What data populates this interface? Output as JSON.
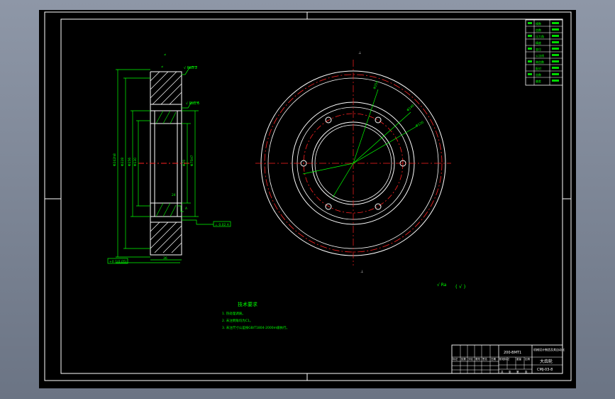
{
  "sheet": {
    "border_color": "#ffffff",
    "accent_colors": {
      "dimension": "#00ff00",
      "centerline": "#ff2020",
      "hatch": "#ffffff",
      "geometry": "#ffffff"
    }
  },
  "side_view": {
    "roughness_label_top": "√ Ra3.2",
    "roughness_label_bore": "√ Ra1.6",
    "tolerance_frame": "⊥ 0.02 A",
    "bottom_dim_left": "+0.1(0.05)",
    "bottom_dim_right": "36",
    "small_mark": "≠",
    "datum_mark": "A"
  },
  "front_view": {
    "top_mark": "⊥",
    "bottom_mark": "⊥"
  },
  "surface_finish_note": {
    "symbol_text": "√ Ra",
    "paren_text": "( √ )"
  },
  "technical_requirements": {
    "title": "技术要求",
    "items": [
      "1. 热处理调质。",
      "2. 未注倒角均为C1。",
      "3. 未注尺寸公差按GB/T1804-2000m级执行。"
    ]
  },
  "param_table": {
    "rows": [
      "模数",
      "齿数",
      "压力角",
      "精度",
      "变位",
      "公法线",
      "跨齿数",
      "配对",
      "齿数",
      "偏差"
    ]
  },
  "title_block": {
    "scale_material": "200-BMT1",
    "school": "机械设计制造及其自动化",
    "part_name": "大齿轮",
    "drawing_number": "CMJ-03-8",
    "grid_labels": [
      "标记",
      "处数",
      "分区",
      "更改",
      "签名",
      "日期"
    ],
    "stage_labels": [
      "阶段标记",
      "重量",
      "比例"
    ],
    "sheet_labels": [
      "共",
      "张",
      "第",
      "张"
    ]
  }
}
